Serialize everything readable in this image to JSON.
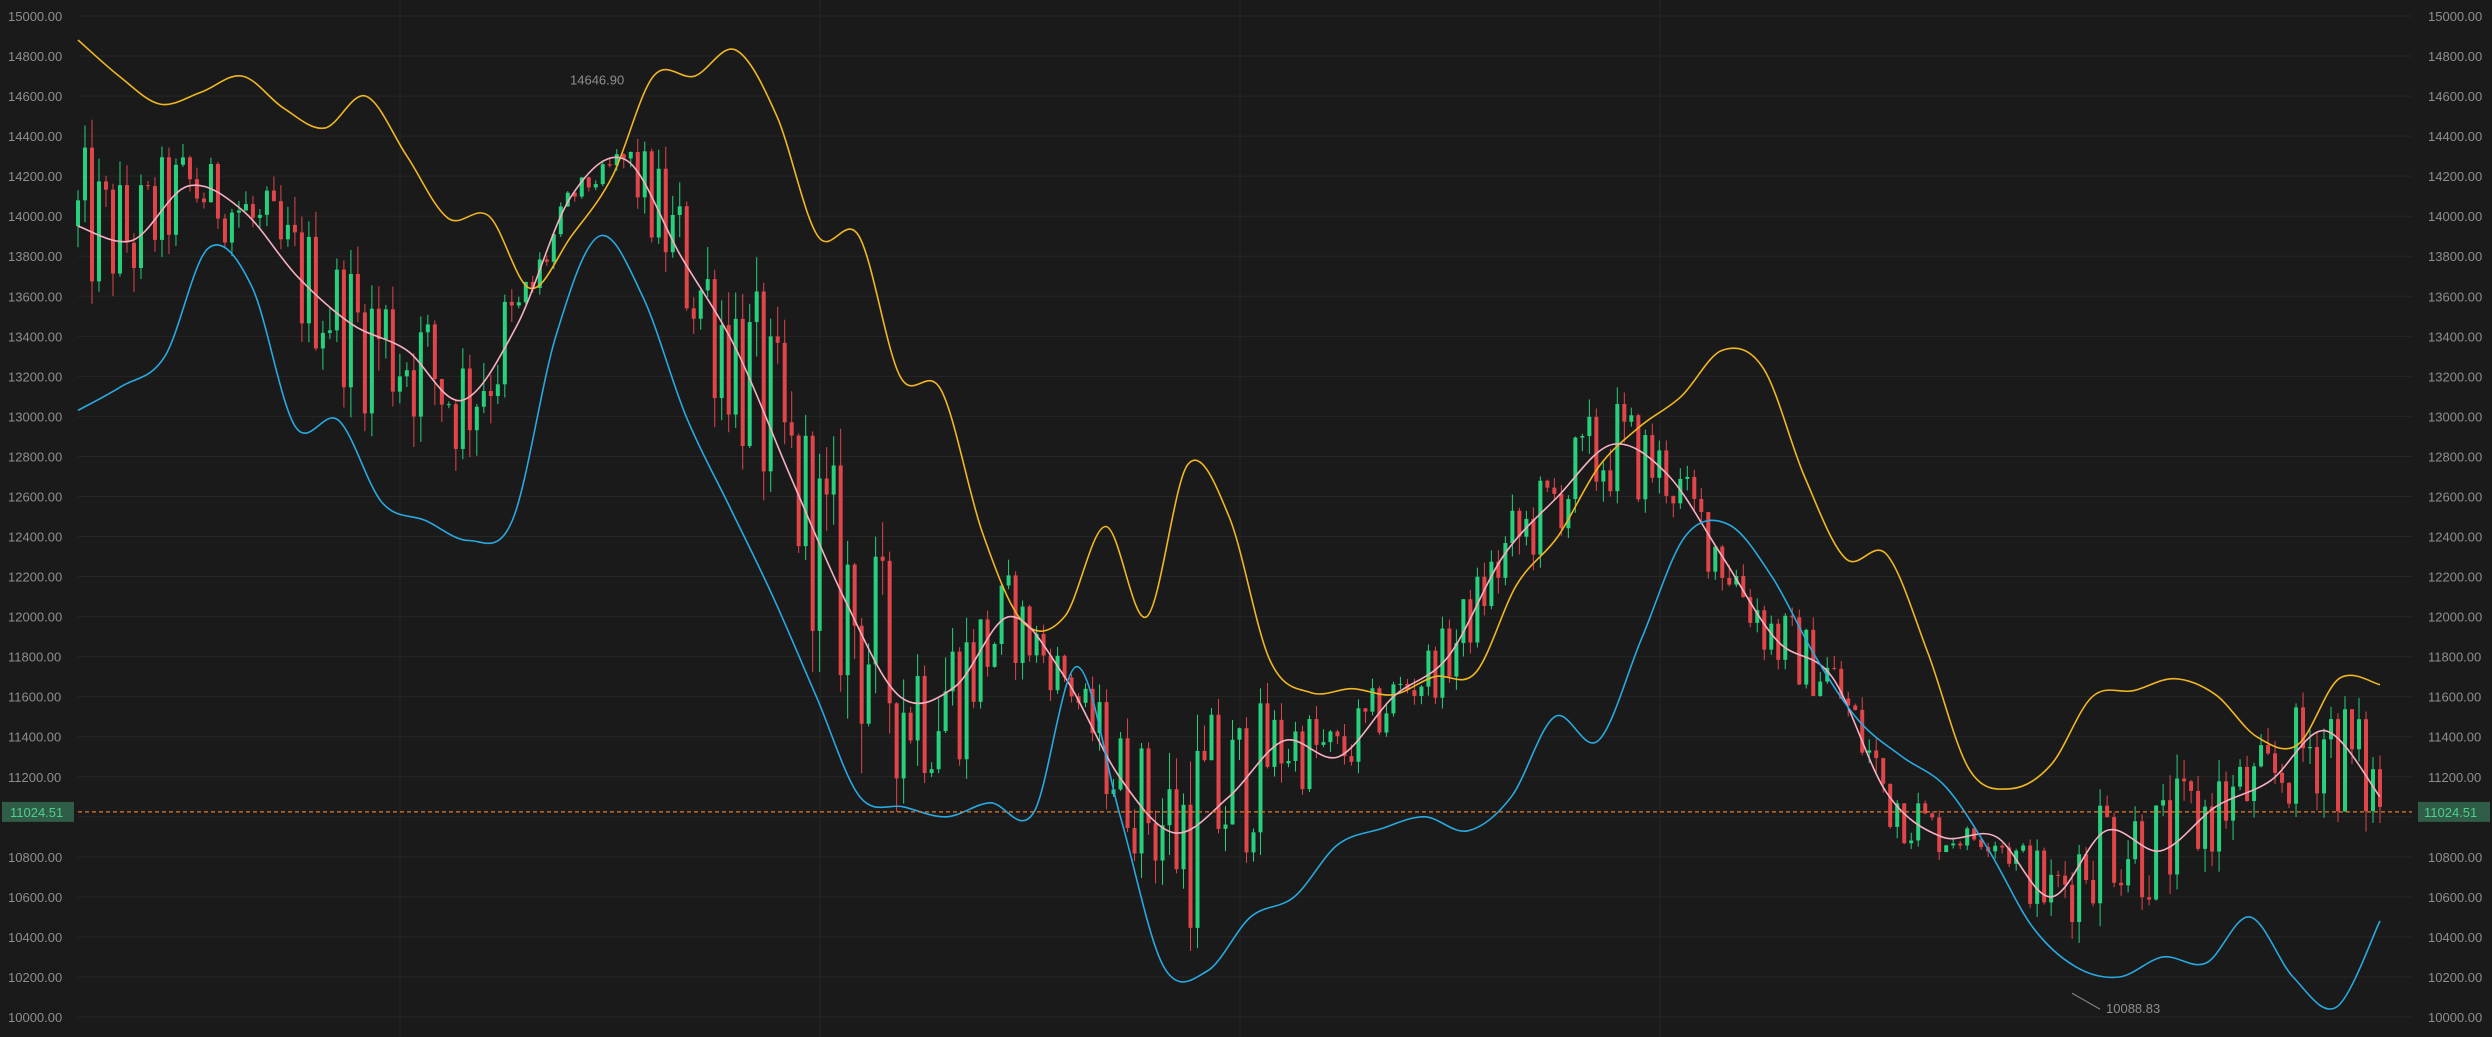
{
  "chart_data": {
    "type": "line",
    "title": "",
    "xlabel": "",
    "ylabel": "",
    "ylim": [
      9980,
      15040
    ],
    "y_ticks": [
      "10000.00",
      "10200.00",
      "10400.00",
      "10600.00",
      "10800.00",
      "11000.00",
      "11200.00",
      "11400.00",
      "11600.00",
      "11800.00",
      "12000.00",
      "12200.00",
      "12400.00",
      "12600.00",
      "12800.00",
      "13000.00",
      "13200.00",
      "13400.00",
      "13600.00",
      "13800.00",
      "14000.00",
      "14200.00",
      "14400.00",
      "14600.00",
      "14800.00",
      "15000.00"
    ],
    "last_price": {
      "label": "11024.51",
      "value": 11024.51
    },
    "annotations": [
      {
        "label": "14646.90",
        "value": 14646.9
      },
      {
        "label": "10088.83",
        "value": 10088.83
      }
    ],
    "colors": {
      "background": "#1a1a1a",
      "grid": "#262626",
      "axis_text": "#8e8e8e",
      "candle_up": "#26d07c",
      "candle_down": "#e0454a",
      "band_upper": "#f0b623",
      "band_middle": "#f5b0c2",
      "band_lower": "#29a9e0",
      "last_price_line": "#e07a2e",
      "last_price_badge": "#2f5d47",
      "last_price_badge_text": "#4ecf8e"
    },
    "series": [
      {
        "role": "upper",
        "values": [
          14880,
          14700,
          14560,
          14620,
          14700,
          14540,
          14440,
          14600,
          14300,
          13990,
          14000,
          13640,
          13900,
          14200,
          14700,
          14700,
          14830,
          14500,
          13900,
          13900,
          13200,
          13130,
          12420,
          11970,
          12000,
          12450,
          12000,
          12760,
          12500,
          11780,
          11620,
          11640,
          11610,
          11700,
          11720,
          12160,
          12400,
          12750,
          12950,
          13100,
          13330,
          13240,
          12700,
          12290,
          12310,
          11820,
          11240,
          11140,
          11260,
          11600,
          11630,
          11690,
          11610,
          11400,
          11360,
          11690,
          11660
        ]
      },
      {
        "role": "middle",
        "values": [
          13950,
          13880,
          14150,
          14030,
          13700,
          13460,
          13330,
          13080,
          13450,
          14100,
          14280,
          13800,
          13340,
          12700,
          12080,
          11600,
          11650,
          12000,
          11700,
          11200,
          10920,
          11100,
          11380,
          11300,
          11600,
          11800,
          12300,
          12600,
          12860,
          12710,
          12300,
          11880,
          11700,
          11120,
          10900,
          10900,
          10600,
          10930,
          10830,
          11050,
          11180,
          11430,
          11100
        ]
      },
      {
        "role": "lower",
        "values": [
          13030,
          13150,
          13300,
          13840,
          13650,
          12950,
          12980,
          12570,
          12480,
          12380,
          12480,
          13400,
          13900,
          13600,
          13000,
          12550,
          12100,
          11600,
          11100,
          11050,
          11000,
          11070,
          11020,
          11750,
          11000,
          10250,
          10230,
          10500,
          10600,
          10860,
          10940,
          11000,
          10930,
          11100,
          11500,
          11380,
          11890,
          12400,
          12460,
          12200,
          11800,
          11480,
          11300,
          11150,
          10830,
          10450,
          10250,
          10200,
          10300,
          10270,
          10500,
          10200,
          10050,
          10480
        ]
      }
    ]
  }
}
